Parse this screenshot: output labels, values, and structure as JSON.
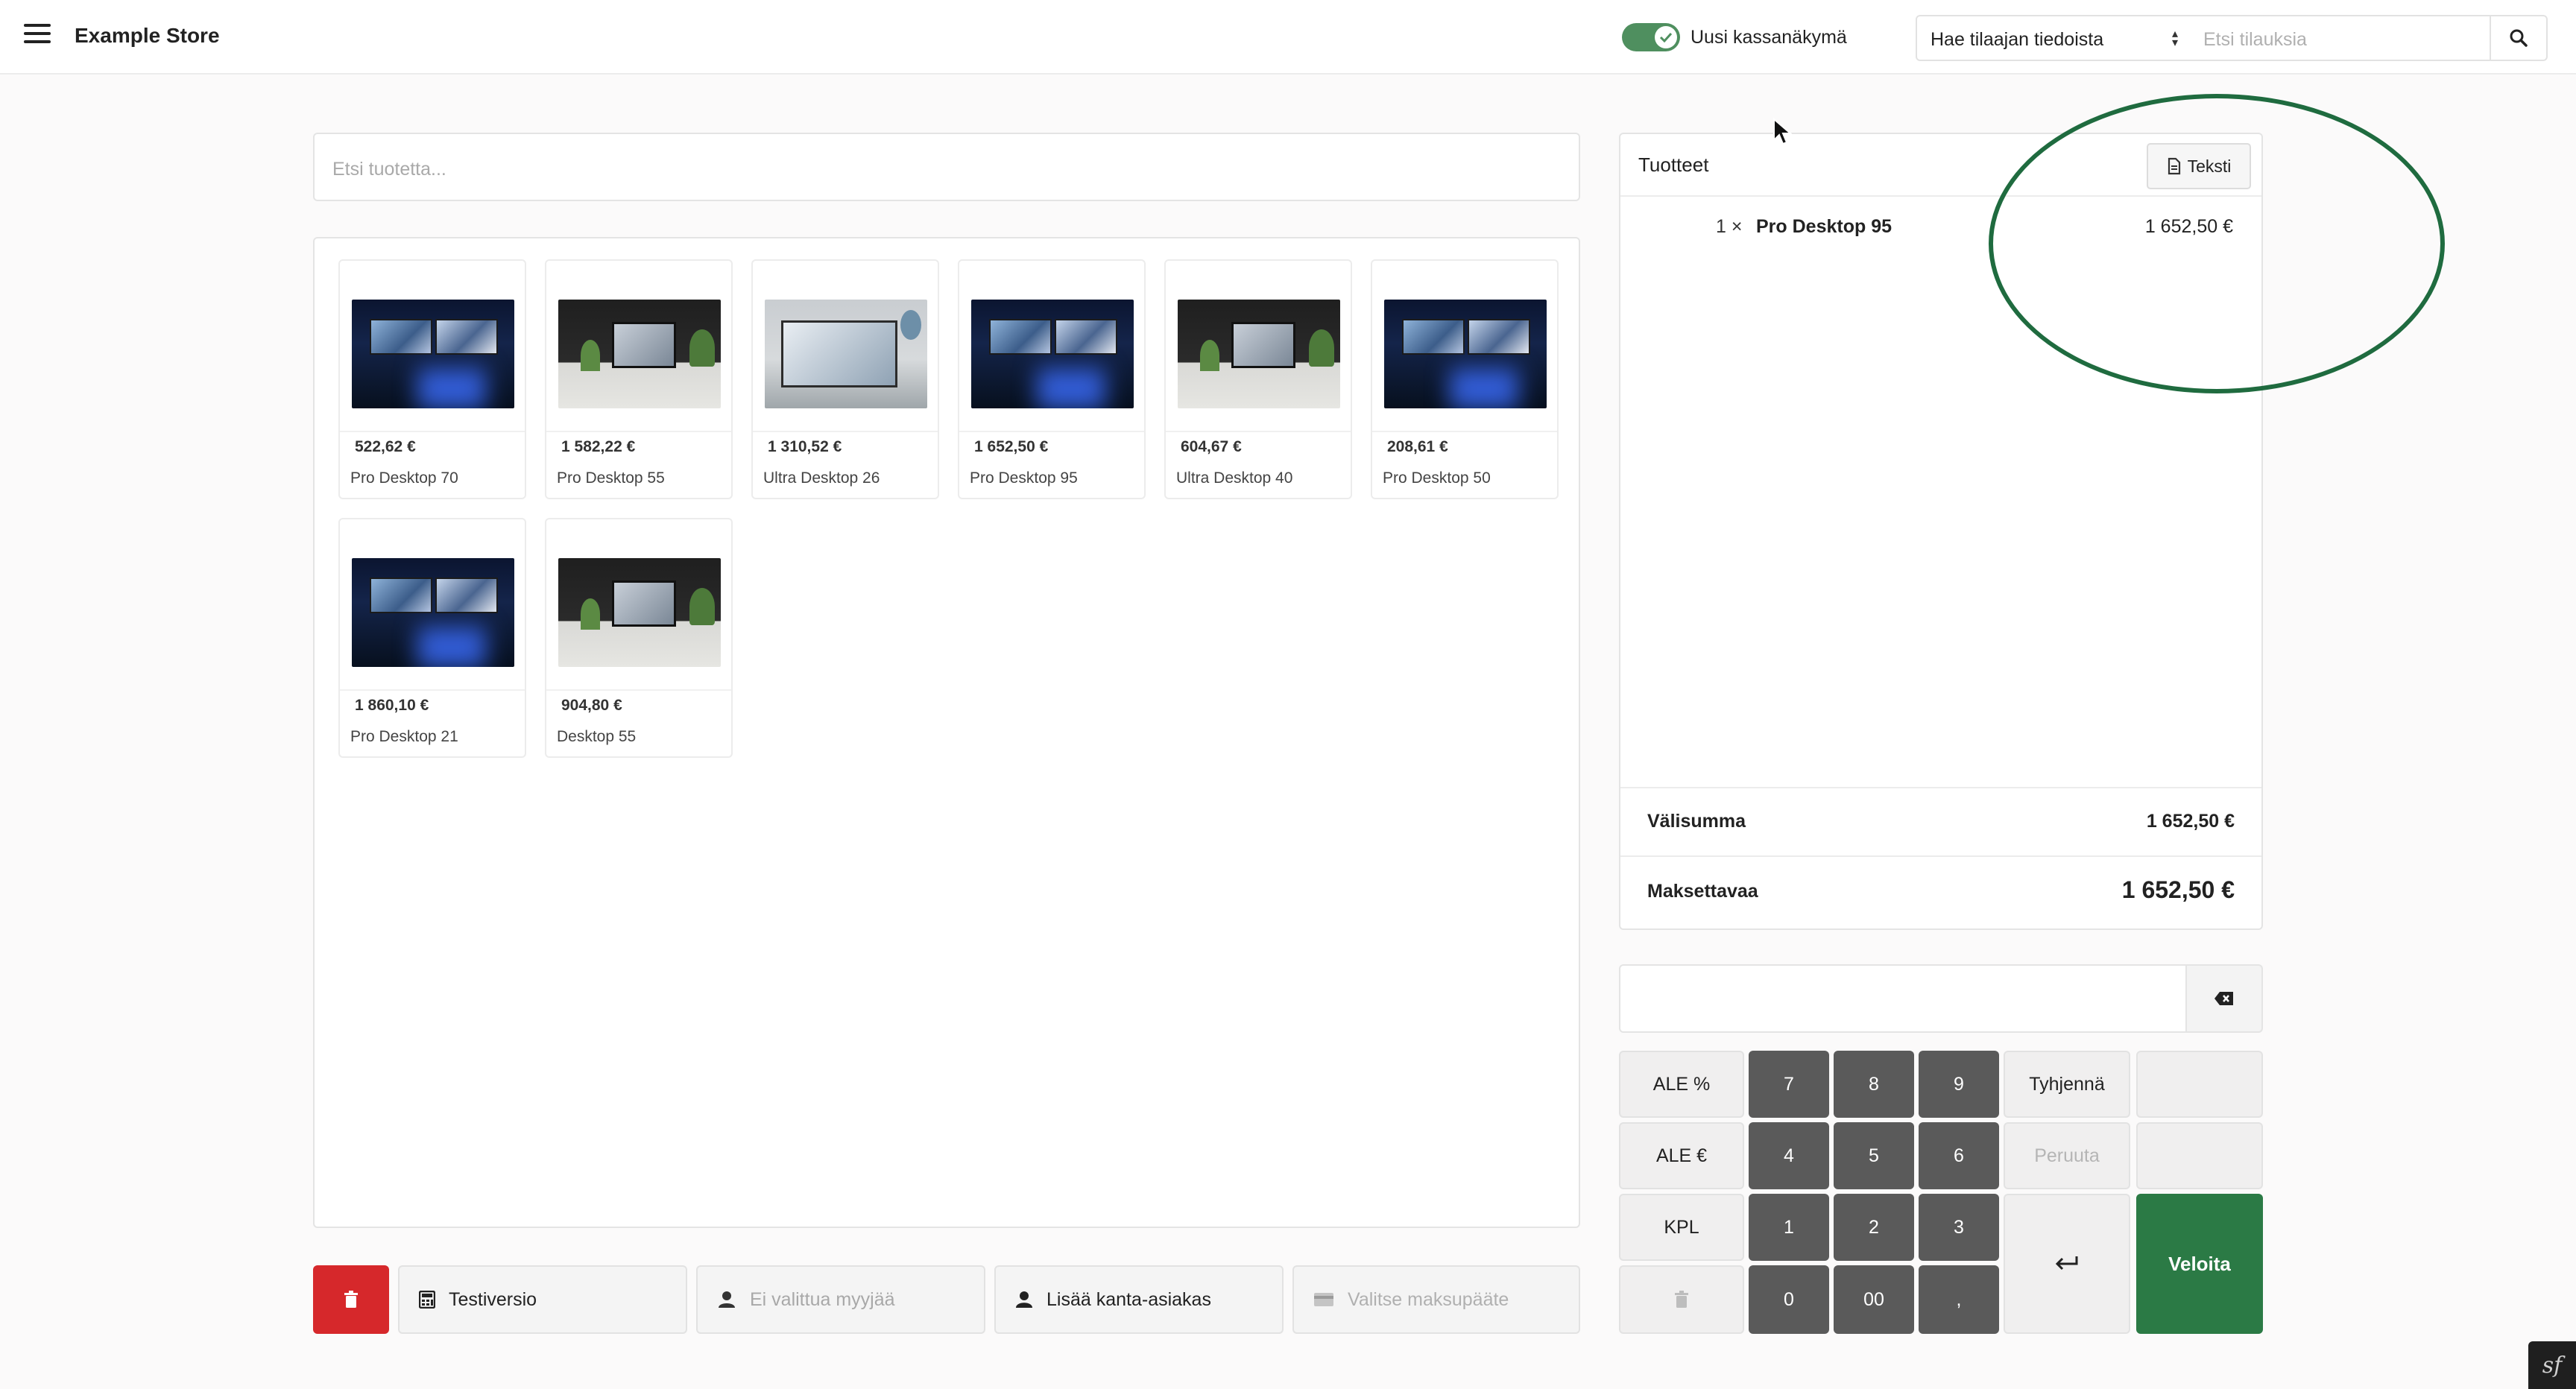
{
  "header": {
    "store_title": "Example Store",
    "toggle_label": "Uusi kassanäkymä",
    "toggle_on": true,
    "customer_select_value": "Hae tilaajan tiedoista",
    "order_search_placeholder": "Etsi tilauksia"
  },
  "product_search": {
    "placeholder": "Etsi tuotetta..."
  },
  "products": [
    {
      "price": "522,62 €",
      "name": "Pro Desktop 70",
      "image": "dark"
    },
    {
      "price": "1 582,22 €",
      "name": "Pro Desktop 55",
      "image": "room"
    },
    {
      "price": "1 310,52 €",
      "name": "Ultra Desktop 26",
      "image": "light"
    },
    {
      "price": "1 652,50 €",
      "name": "Pro Desktop 95",
      "image": "dark"
    },
    {
      "price": "604,67 €",
      "name": "Ultra Desktop 40",
      "image": "room"
    },
    {
      "price": "208,61 €",
      "name": "Pro Desktop 50",
      "image": "dark"
    },
    {
      "price": "1 860,10 €",
      "name": "Pro Desktop 21",
      "image": "dark"
    },
    {
      "price": "904,80 €",
      "name": "Desktop 55",
      "image": "room"
    }
  ],
  "cart": {
    "title": "Tuotteet",
    "text_button": "Teksti",
    "lines": [
      {
        "qty": "1 ×",
        "name": "Pro Desktop 95",
        "price": "1 652,50 €"
      }
    ],
    "subtotal_label": "Välisumma",
    "subtotal_value": "1 652,50 €",
    "total_label": "Maksettavaa",
    "total_value": "1 652,50 €"
  },
  "keypad": {
    "input_value": "",
    "discount_percent": "ALE %",
    "discount_euro": "ALE €",
    "quantity": "KPL",
    "digits": [
      "7",
      "8",
      "9",
      "4",
      "5",
      "6",
      "1",
      "2",
      "3",
      "0",
      "00",
      ","
    ],
    "clear": "Tyhjennä",
    "cancel": "Peruuta",
    "charge": "Veloita"
  },
  "bottom_bar": {
    "test_version": "Testiversio",
    "seller": "Ei valittua myyjää",
    "add_customer": "Lisää kanta-asiakas",
    "payment_terminal": "Valitse maksupääte"
  },
  "colors": {
    "accent_green": "#2b7a45",
    "annotation_green": "#1f6b3f",
    "danger_red": "#d6282b",
    "keypad_dark": "#5a5a5a"
  }
}
